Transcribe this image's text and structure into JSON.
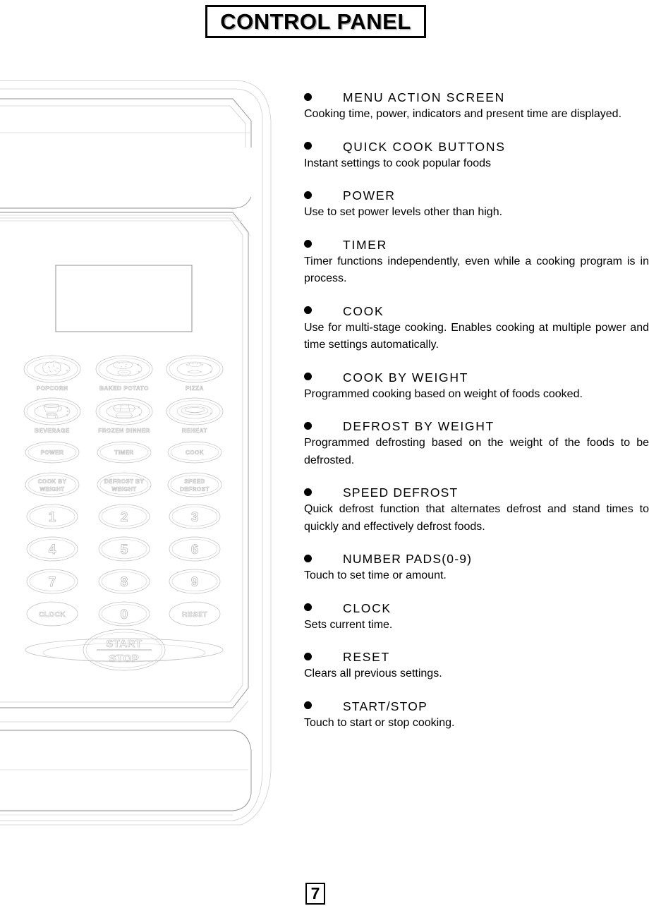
{
  "page": {
    "title": "CONTROL PANEL",
    "number": "7"
  },
  "sections": [
    {
      "heading": "MENU ACTION SCREEN",
      "body": "Cooking time, power, indicators and present time are displayed."
    },
    {
      "heading": "QUICK COOK BUTTONS",
      "body": "Instant settings to cook popular foods"
    },
    {
      "heading": "POWER",
      "body": "Use to set power levels other than high."
    },
    {
      "heading": "TIMER",
      "body": "Timer functions independently, even while a cooking program is in process."
    },
    {
      "heading": "COOK",
      "body": "Use for multi-stage cooking.  Enables cooking at multiple power and time settings automatically."
    },
    {
      "heading": "COOK BY WEIGHT",
      "body": "Programmed cooking based on weight of foods cooked."
    },
    {
      "heading": "DEFROST BY WEIGHT",
      "body": "Programmed defrosting based on the weight of the foods to be defrosted."
    },
    {
      "heading": "SPEED DEFROST",
      "body": "Quick defrost function that alternates defrost and stand times to quickly and effectively defrost foods."
    },
    {
      "heading": "NUMBER PADS(0-9)",
      "body": "Touch to set time or amount."
    },
    {
      "heading": "CLOCK",
      "body": "Sets current time."
    },
    {
      "heading": "RESET",
      "body": "Clears all previous settings."
    },
    {
      "heading": "START/STOP",
      "body": "Touch to start or stop cooking."
    }
  ],
  "control_panel": {
    "quick_cook_buttons": [
      {
        "label": "POPCORN",
        "icon": "popcorn-icon"
      },
      {
        "label": "BAKED POTATO",
        "icon": "baked-potato-icon"
      },
      {
        "label": "PIZZA",
        "icon": "pizza-icon"
      },
      {
        "label": "BEVERAGE",
        "icon": "beverage-icon"
      },
      {
        "label": "FROZEN DINNER",
        "icon": "frozen-dinner-icon"
      },
      {
        "label": "REHEAT",
        "icon": "reheat-icon"
      }
    ],
    "function_buttons": [
      {
        "label": "POWER"
      },
      {
        "label": "TIMER"
      },
      {
        "label": "COOK"
      },
      {
        "label_line1": "COOK BY",
        "label_line2": "WEIGHT"
      },
      {
        "label_line1": "DEFROST BY",
        "label_line2": "WEIGHT"
      },
      {
        "label_line1": "SPEED",
        "label_line2": "DEFROST"
      }
    ],
    "number_pads": [
      "1",
      "2",
      "3",
      "4",
      "5",
      "6",
      "7",
      "8",
      "9"
    ],
    "bottom_row": [
      "CLOCK",
      "0",
      "RESET"
    ],
    "start_stop": {
      "line1": "START",
      "line2": "STOP"
    }
  },
  "colors": {
    "ink": "#000000",
    "drawing_line": "#8f8f8f",
    "drawing_line_light": "#cdcdcd",
    "button_outline": "#bdbdbd",
    "background": "#ffffff"
  }
}
